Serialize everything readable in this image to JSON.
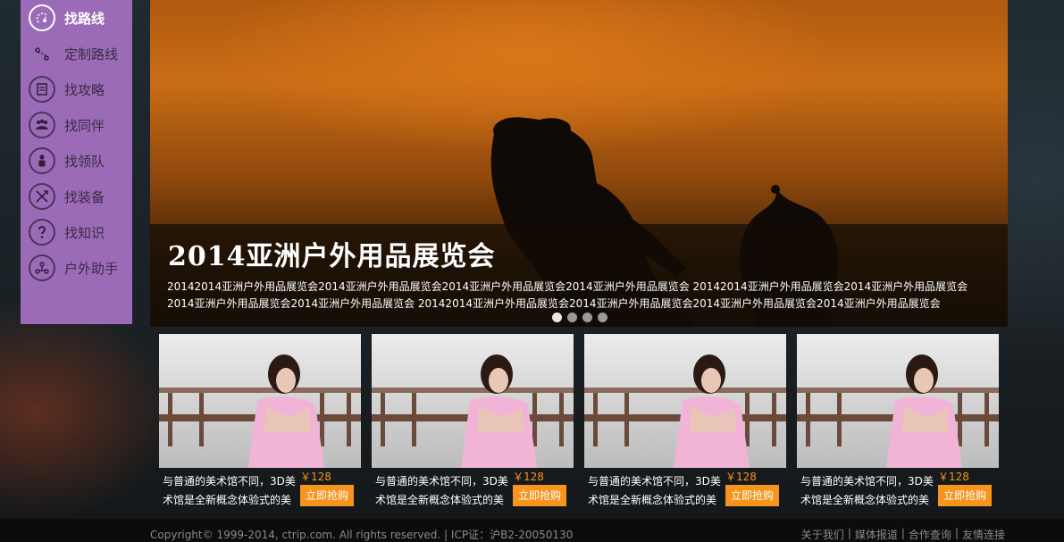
{
  "sidebar": {
    "items": [
      {
        "label": "找路线",
        "icon": "route-icon",
        "active": true
      },
      {
        "label": "定制路线",
        "icon": "custom-route-icon",
        "active": false
      },
      {
        "label": "找攻略",
        "icon": "guide-book-icon",
        "active": false
      },
      {
        "label": "找同伴",
        "icon": "companions-icon",
        "active": false
      },
      {
        "label": "找领队",
        "icon": "leader-icon",
        "active": false
      },
      {
        "label": "找装备",
        "icon": "equipment-icon",
        "active": false
      },
      {
        "label": "找知识",
        "icon": "knowledge-icon",
        "active": false
      },
      {
        "label": "户外助手",
        "icon": "assistant-icon",
        "active": false
      }
    ]
  },
  "hero": {
    "title": "2014亚洲户外用品展览会",
    "desc": "20142014亚洲户外用品展览会2014亚洲户外用品展览会2014亚洲户外用品展览会2014亚洲户外用品展览会 20142014亚洲户外用品展览会2014亚洲户外用品展览会2014亚洲户外用品展览会2014亚洲户外用品展览会 20142014亚洲户外用品展览会2014亚洲户外用品展览会2014亚洲户外用品展览会2014亚洲户外用品展览会",
    "slides": 4,
    "active_slide": 1
  },
  "cards": [
    {
      "text": "与普通的美术馆不同，3D美术馆是全新概念体验式的美",
      "price": "￥128",
      "button": "立即抢购"
    },
    {
      "text": "与普通的美术馆不同，3D美术馆是全新概念体验式的美",
      "price": "￥128",
      "button": "立即抢购"
    },
    {
      "text": "与普通的美术馆不同，3D美术馆是全新概念体验式的美",
      "price": "￥128",
      "button": "立即抢购"
    },
    {
      "text": "与普通的美术馆不同，3D美术馆是全新概念体验式的美",
      "price": "￥128",
      "button": "立即抢购"
    }
  ],
  "footer": {
    "copyright": "Copyright© 1999-2014, ctrip.com. All rights reserved. | ICP证：沪B2-20050130",
    "links": [
      "关于我们",
      "媒体报道",
      "合作查询",
      "友情连接"
    ]
  },
  "colors": {
    "sidebar_bg": "#9b6bb7",
    "accent": "#f7941d"
  }
}
